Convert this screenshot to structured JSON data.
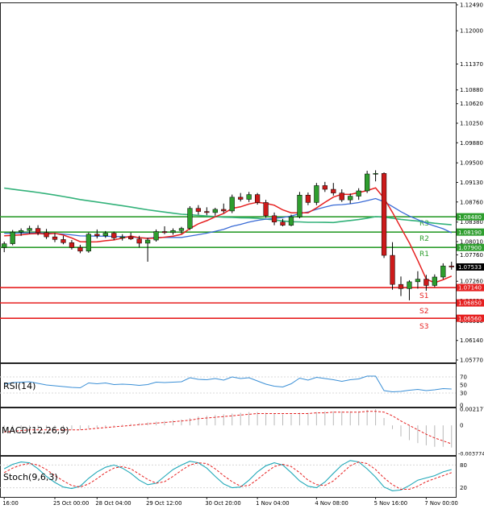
{
  "chart_data": {
    "type": "candlestick",
    "main": {
      "ylim": [
        1.0577,
        1.1249
      ],
      "y_ticks": [
        "1.12490",
        "1.12000",
        "1.11370",
        "1.10880",
        "1.10620",
        "1.10250",
        "1.09880",
        "1.09500",
        "1.09130",
        "1.08760",
        "1.08380",
        "1.08010",
        "1.07760",
        "1.07260",
        "1.06890",
        "1.06510",
        "1.06140",
        "1.05770"
      ],
      "levels": [
        {
          "name": "R3",
          "value": 1.0848,
          "label": "1.08480",
          "color": "#2e9e2e"
        },
        {
          "name": "R2",
          "value": 1.0819,
          "label": "1.08190",
          "color": "#2e9e2e"
        },
        {
          "name": "R1",
          "value": 1.079,
          "label": "1.07900",
          "color": "#2e9e2e"
        },
        {
          "name": "S1",
          "value": 1.0714,
          "label": "1.07140",
          "color": "#e62020"
        },
        {
          "name": "S2",
          "value": 1.0685,
          "label": "1.06850",
          "color": "#e62020"
        },
        {
          "name": "S3",
          "value": 1.0656,
          "label": "1.06560",
          "color": "#e62020"
        }
      ],
      "current_price": {
        "value": 1.0753,
        "label": "1.07533"
      },
      "candles": [
        [
          1.079,
          1.0801,
          1.0781,
          1.0797
        ],
        [
          1.0797,
          1.0823,
          1.0794,
          1.0819
        ],
        [
          1.0819,
          1.0826,
          1.0812,
          1.0822
        ],
        [
          1.0822,
          1.0831,
          1.0816,
          1.0826
        ],
        [
          1.0826,
          1.0832,
          1.0813,
          1.0818
        ],
        [
          1.0818,
          1.0825,
          1.0806,
          1.081
        ],
        [
          1.081,
          1.0817,
          1.08,
          1.0805
        ],
        [
          1.0805,
          1.0812,
          1.0796,
          1.0799
        ],
        [
          1.0799,
          1.0804,
          1.0786,
          1.079
        ],
        [
          1.079,
          1.0795,
          1.0779,
          1.0783
        ],
        [
          1.0783,
          1.0818,
          1.078,
          1.0815
        ],
        [
          1.0815,
          1.0824,
          1.0807,
          1.0812
        ],
        [
          1.0812,
          1.0821,
          1.0808,
          1.0817
        ],
        [
          1.0817,
          1.082,
          1.0804,
          1.0808
        ],
        [
          1.0808,
          1.0815,
          1.0803,
          1.081
        ],
        [
          1.081,
          1.0818,
          1.0804,
          1.0806
        ],
        [
          1.0806,
          1.0812,
          1.079,
          1.0798
        ],
        [
          1.0798,
          1.0808,
          1.0763,
          1.0804
        ],
        [
          1.0804,
          1.0824,
          1.0801,
          1.082
        ],
        [
          1.082,
          1.083,
          1.0815,
          1.0818
        ],
        [
          1.0818,
          1.0826,
          1.0814,
          1.0822
        ],
        [
          1.0822,
          1.0829,
          1.0816,
          1.0826
        ],
        [
          1.0826,
          1.0868,
          1.0823,
          1.0864
        ],
        [
          1.0864,
          1.087,
          1.0852,
          1.0858
        ],
        [
          1.0858,
          1.0866,
          1.0851,
          1.0856
        ],
        [
          1.0856,
          1.0865,
          1.085,
          1.0862
        ],
        [
          1.0862,
          1.0873,
          1.0855,
          1.0859
        ],
        [
          1.0859,
          1.089,
          1.0855,
          1.0885
        ],
        [
          1.0885,
          1.0893,
          1.0877,
          1.0881
        ],
        [
          1.0881,
          1.0895,
          1.0876,
          1.089
        ],
        [
          1.089,
          1.0893,
          1.0871,
          1.0875
        ],
        [
          1.0875,
          1.088,
          1.0846,
          1.085
        ],
        [
          1.085,
          1.0856,
          1.0832,
          1.0838
        ],
        [
          1.0838,
          1.0844,
          1.083,
          1.0832
        ],
        [
          1.0832,
          1.0852,
          1.083,
          1.0848
        ],
        [
          1.0848,
          1.0895,
          1.0845,
          1.0889
        ],
        [
          1.0889,
          1.0894,
          1.087,
          1.0875
        ],
        [
          1.0875,
          1.0912,
          1.087,
          1.0907
        ],
        [
          1.0907,
          1.0914,
          1.0895,
          1.09
        ],
        [
          1.09,
          1.0912,
          1.0888,
          1.0893
        ],
        [
          1.0893,
          1.09,
          1.0876,
          1.088
        ],
        [
          1.088,
          1.0892,
          1.0873,
          1.0887
        ],
        [
          1.0887,
          1.0902,
          1.088,
          1.0897
        ],
        [
          1.0897,
          1.0935,
          1.0893,
          1.0929
        ],
        [
          1.0929,
          1.0936,
          1.0915,
          1.093
        ],
        [
          1.093,
          1.0932,
          1.077,
          1.0775
        ],
        [
          1.0775,
          1.08,
          1.071,
          1.072
        ],
        [
          1.072,
          1.0735,
          1.0698,
          1.0712
        ],
        [
          1.0712,
          1.0728,
          1.069,
          1.0725
        ],
        [
          1.0725,
          1.0745,
          1.0712,
          1.073
        ],
        [
          1.073,
          1.0738,
          1.0708,
          1.0718
        ],
        [
          1.0718,
          1.0739,
          1.0715,
          1.0734
        ],
        [
          1.0734,
          1.076,
          1.073,
          1.0755
        ],
        [
          1.0755,
          1.0763,
          1.0748,
          1.0753
        ]
      ]
    },
    "rsi": {
      "label": "RSI(14)",
      "ylim": [
        0,
        100
      ],
      "y_ticks": [
        70,
        50,
        30,
        0
      ],
      "values": [
        52,
        56,
        57,
        58,
        54,
        50,
        48,
        46,
        44,
        43,
        55,
        53,
        55,
        51,
        52,
        51,
        49,
        51,
        57,
        56,
        57,
        58,
        68,
        64,
        63,
        66,
        62,
        70,
        66,
        68,
        60,
        52,
        47,
        45,
        53,
        67,
        62,
        69,
        66,
        63,
        59,
        63,
        65,
        72,
        72,
        36,
        33,
        34,
        37,
        39,
        36,
        38,
        41,
        40
      ]
    },
    "macd": {
      "label": "MACD(12,26,9)",
      "y_ticks": [
        "0.002177",
        "0",
        "-0.003774"
      ],
      "ylim": [
        -0.0038,
        0.0022
      ],
      "hist": [
        -0.0008,
        -0.0007,
        -0.0006,
        -0.0005,
        -0.0005,
        -0.0005,
        -0.0005,
        -0.0005,
        -0.0006,
        -0.0006,
        -0.0004,
        -0.0003,
        -0.0002,
        -0.0001,
        0.0001,
        0.0002,
        0.0003,
        0.0004,
        0.0005,
        0.0006,
        0.0007,
        0.0008,
        0.001,
        0.0012,
        0.0013,
        0.0014,
        0.0015,
        0.0016,
        0.0017,
        0.0018,
        0.0018,
        0.0017,
        0.0016,
        0.0015,
        0.0015,
        0.0017,
        0.0017,
        0.0018,
        0.0019,
        0.0019,
        0.0019,
        0.0019,
        0.0019,
        0.0021,
        0.0022,
        0.001,
        -0.0005,
        -0.0015,
        -0.002,
        -0.0024,
        -0.0027,
        -0.0029,
        -0.0029,
        -0.003
      ],
      "signal": [
        -0.0009,
        -0.0008,
        -0.0007,
        -0.0006,
        -0.0006,
        -0.0006,
        -0.0006,
        -0.0006,
        -0.0006,
        -0.0006,
        -0.0005,
        -0.0004,
        -0.0003,
        -0.0002,
        -0.0001,
        0.0,
        0.0001,
        0.0002,
        0.0003,
        0.0004,
        0.0005,
        0.0006,
        0.0007,
        0.0009,
        0.001,
        0.0011,
        0.0012,
        0.0013,
        0.0014,
        0.0015,
        0.0016,
        0.0016,
        0.0016,
        0.0016,
        0.0016,
        0.0016,
        0.0016,
        0.0017,
        0.0017,
        0.0018,
        0.0018,
        0.0018,
        0.0018,
        0.0019,
        0.0019,
        0.0018,
        0.0013,
        0.0006,
        0.0,
        -0.0006,
        -0.0012,
        -0.0017,
        -0.0021,
        -0.0025
      ]
    },
    "stoch": {
      "label": "Stoch(9,6,3)",
      "ylim": [
        0,
        100
      ],
      "y_ticks": [
        80,
        20
      ],
      "k": [
        70,
        82,
        88,
        86,
        70,
        50,
        34,
        22,
        18,
        24,
        45,
        62,
        74,
        80,
        72,
        58,
        40,
        28,
        32,
        50,
        68,
        80,
        90,
        86,
        72,
        50,
        30,
        20,
        22,
        40,
        62,
        78,
        86,
        80,
        60,
        38,
        24,
        20,
        35,
        58,
        80,
        92,
        88,
        70,
        48,
        22,
        12,
        14,
        26,
        40,
        46,
        52,
        62,
        68
      ],
      "d": [
        60,
        72,
        80,
        84,
        80,
        68,
        52,
        38,
        26,
        22,
        30,
        44,
        60,
        72,
        76,
        70,
        56,
        42,
        32,
        36,
        50,
        66,
        80,
        86,
        84,
        70,
        52,
        36,
        24,
        26,
        42,
        60,
        76,
        82,
        76,
        60,
        40,
        28,
        26,
        38,
        58,
        78,
        88,
        84,
        68,
        46,
        28,
        16,
        16,
        24,
        36,
        44,
        52,
        60
      ]
    },
    "x_ticks": [
      {
        "i": 0,
        "label": "16:00"
      },
      {
        "i": 6,
        "label": "25 Oct 00:00"
      },
      {
        "i": 11,
        "label": "28 Oct 04:00"
      },
      {
        "i": 17,
        "label": "29 Oct 12:00"
      },
      {
        "i": 24,
        "label": "30 Oct 20:00"
      },
      {
        "i": 30,
        "label": "1 Nov 04:00"
      },
      {
        "i": 37,
        "label": "4 Nov 08:00"
      },
      {
        "i": 44,
        "label": "5 Nov 16:00"
      },
      {
        "i": 50,
        "label": "7 Nov 00:00"
      }
    ],
    "colors": {
      "bull": "#2e9e2e",
      "bear": "#cc1a1a",
      "ma_fast": "#e62020",
      "ma_mid": "#3a6bd6",
      "ma_slow": "#33b27a",
      "rsi_line": "#3a8fd6",
      "macd_hist": "#b8b8b8",
      "macd_signal": "#e62020",
      "stoch_k": "#20a8b8",
      "stoch_d": "#e62020"
    }
  }
}
